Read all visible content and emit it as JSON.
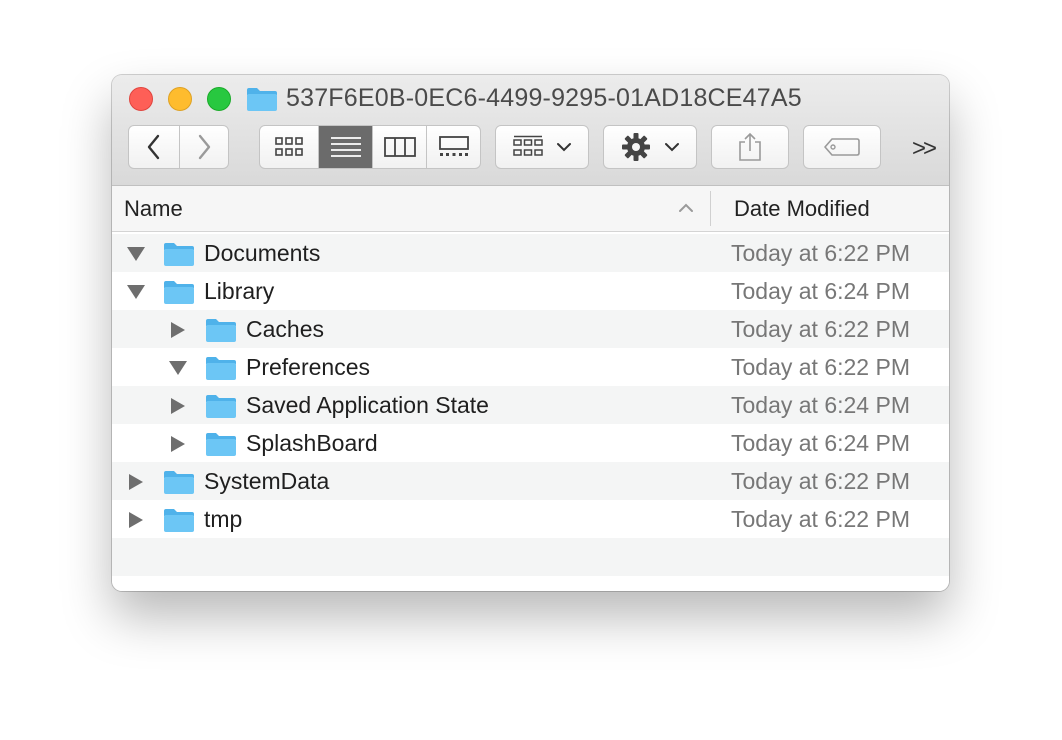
{
  "window": {
    "title": "537F6E0B-0EC6-4499-9295-01AD18CE47A5"
  },
  "toolbar": {
    "back_icon": "chevron-left-icon",
    "forward_icon": "chevron-right-icon",
    "view_modes": [
      "icon-view",
      "list-view",
      "column-view",
      "gallery-view"
    ],
    "active_view": "list-view",
    "group_icon": "group-grid-icon",
    "action_icon": "gear-icon",
    "share_icon": "share-icon",
    "tag_icon": "tag-icon",
    "more_label": ">>"
  },
  "columns": {
    "name": "Name",
    "date_modified": "Date Modified",
    "sort": "ascending"
  },
  "rows": [
    {
      "name": "Documents",
      "date": "Today at 6:22 PM",
      "level": 0,
      "expanded": true
    },
    {
      "name": "Library",
      "date": "Today at 6:24 PM",
      "level": 0,
      "expanded": true
    },
    {
      "name": "Caches",
      "date": "Today at 6:22 PM",
      "level": 1,
      "expanded": false
    },
    {
      "name": "Preferences",
      "date": "Today at 6:22 PM",
      "level": 1,
      "expanded": true
    },
    {
      "name": "Saved Application State",
      "date": "Today at 6:24 PM",
      "level": 1,
      "expanded": false
    },
    {
      "name": "SplashBoard",
      "date": "Today at 6:24 PM",
      "level": 1,
      "expanded": false
    },
    {
      "name": "SystemData",
      "date": "Today at 6:22 PM",
      "level": 0,
      "expanded": false
    },
    {
      "name": "tmp",
      "date": "Today at 6:22 PM",
      "level": 0,
      "expanded": false
    }
  ],
  "colors": {
    "folder": "#6cc6f5",
    "folder_tab": "#4fb2ea",
    "active_segment": "#6b6b6b"
  }
}
